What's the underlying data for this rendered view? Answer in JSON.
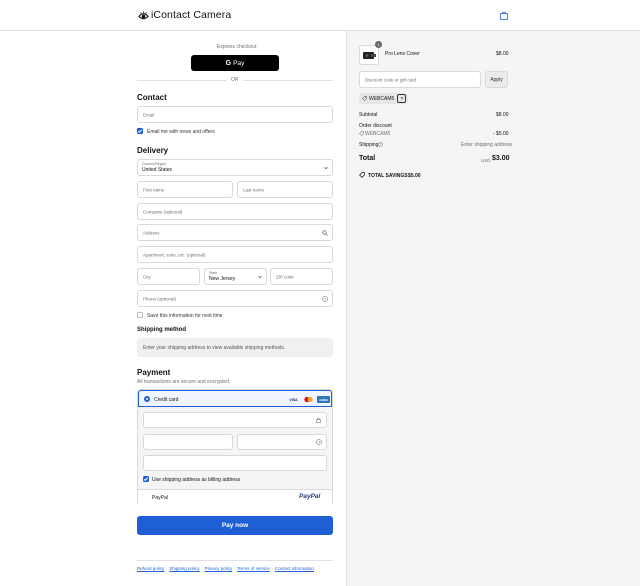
{
  "header": {
    "brand": "iContact Camera",
    "logo_icon": "eye-logo-icon",
    "cart_icon": "shopping-bag-icon"
  },
  "express": {
    "label": "Express checkout",
    "gpay_label": "Pay",
    "gpay_g": "G",
    "or": "OR"
  },
  "contact": {
    "title": "Contact",
    "email_placeholder": "Email",
    "news_label": "Email me with news and offers",
    "news_checked": true
  },
  "delivery": {
    "title": "Delivery",
    "country_label": "Country/Region",
    "country_value": "United States",
    "first_name": "First name",
    "last_name": "Last name",
    "company": "Company (optional)",
    "address": "Address",
    "apartment": "Apartment, suite, etc. (optional)",
    "city": "City",
    "state_label": "State",
    "state_value": "New Jersey",
    "zip": "ZIP code",
    "phone": "Phone (optional)",
    "save_label": "Save this information for next time",
    "save_checked": false
  },
  "shipping": {
    "title": "Shipping method",
    "notice": "Enter your shipping address to view available shipping methods."
  },
  "payment": {
    "title": "Payment",
    "subtitle": "All transactions are secure and encrypted.",
    "credit_card": "Credit card",
    "card_brands": [
      "VISA",
      "mastercard",
      "AMEX"
    ],
    "billing_label": "Use shipping address as billing address",
    "billing_checked": true,
    "paypal_label": "PayPal",
    "paypal_logo": "PayPal"
  },
  "pay_button": "Pay now",
  "footer_links": [
    "Refund policy",
    "Shipping policy",
    "Privacy policy",
    "Terms of service",
    "Contact information"
  ],
  "summary": {
    "item_name": "Pro Lens Cover",
    "item_qty": "1",
    "item_price": "$8.00",
    "discount_placeholder": "Discount code or gift card",
    "apply": "Apply",
    "applied_code": "WEBCAM5",
    "subtotal_label": "Subtotal",
    "subtotal_value": "$8.00",
    "order_discount_label": "Order discount",
    "discount_code": "WEBCAM5",
    "discount_value": "- $5.00",
    "shipping_label": "Shipping",
    "shipping_value": "Enter shipping address",
    "total_label": "Total",
    "total_currency": "USD",
    "total_value": "$3.00",
    "savings_label": "TOTAL SAVINGS",
    "savings_value": "$5.00"
  },
  "colors": {
    "accent": "#1f5fd6",
    "panel": "#f5f5f5",
    "border": "#d9d9d9"
  }
}
